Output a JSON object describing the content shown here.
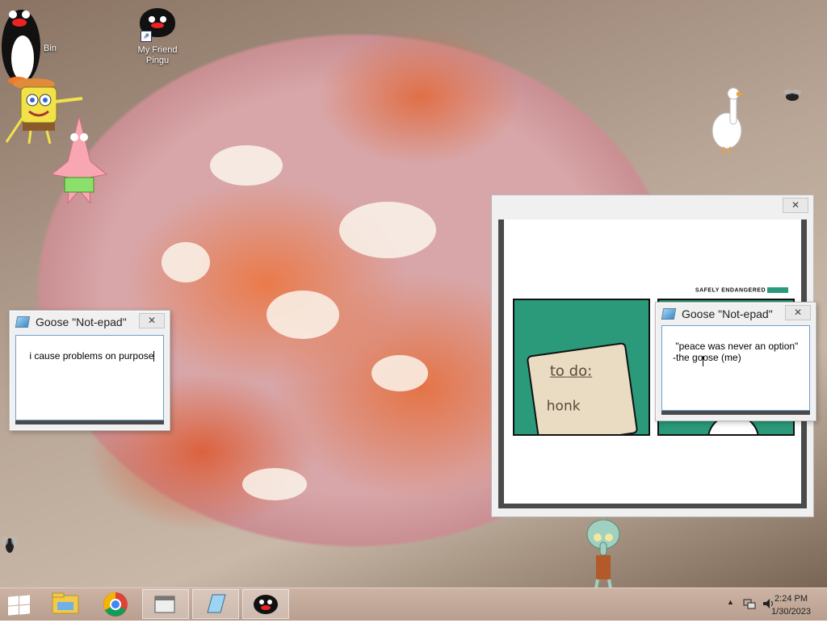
{
  "desktop": {
    "icons": [
      {
        "label": "Bin"
      },
      {
        "label": "My Friend\nPingu"
      }
    ]
  },
  "windows": [
    {
      "id": "notepad-left",
      "title": "Goose \"Not-epad\"",
      "close_label": "✕",
      "text": "i cause problems on purpose"
    },
    {
      "id": "notepad-right",
      "title": "Goose \"Not-epad\"",
      "close_label": "✕",
      "text": "\"peace was never an option\"\n   -the goose (me)"
    },
    {
      "id": "image-window",
      "close_label": "✕"
    }
  ],
  "comic": {
    "credit": "SAFELY ENDANGERED",
    "note_line1": "to do:",
    "note_line2": "honk",
    "panel_color": "#2a9a7a"
  },
  "taskbar": {
    "apps": [
      {
        "name": "file-explorer-icon"
      },
      {
        "name": "chrome-icon"
      },
      {
        "name": "folder-window-icon"
      },
      {
        "name": "notepad-icon"
      },
      {
        "name": "pingu-icon"
      }
    ],
    "clock": {
      "time": "2:24 PM",
      "date": "1/30/2023"
    }
  },
  "colors": {
    "accent": "#6f9fd1",
    "taskbar": "#c4ab9c"
  }
}
